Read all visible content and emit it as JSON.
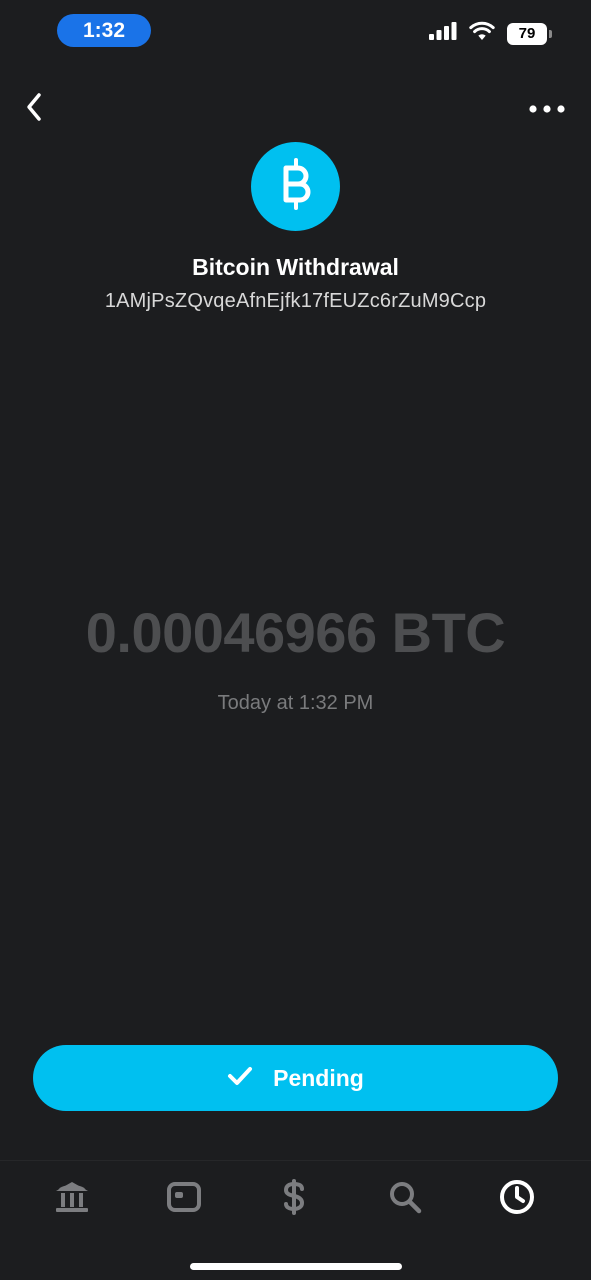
{
  "status_bar": {
    "time": "1:32",
    "battery": "79"
  },
  "header": {
    "back_icon": "chevron-left-icon",
    "more_icon": "more-horizontal-icon"
  },
  "transaction": {
    "icon": "bitcoin-icon",
    "title": "Bitcoin Withdrawal",
    "address": "1AMjPsZQvqeAfnEjfk17fEUZc6rZuM9Ccp",
    "amount": "0.00046966 BTC",
    "timestamp": "Today at 1:32 PM"
  },
  "status_button": {
    "label": "Pending",
    "icon": "checkmark-icon"
  },
  "tabs": [
    {
      "name": "banking",
      "icon": "bank-icon",
      "active": false
    },
    {
      "name": "card",
      "icon": "card-icon",
      "active": false
    },
    {
      "name": "pay",
      "icon": "dollar-icon",
      "active": false
    },
    {
      "name": "discover",
      "icon": "search-icon",
      "active": false
    },
    {
      "name": "activity",
      "icon": "clock-icon",
      "active": true
    }
  ],
  "colors": {
    "background": "#1c1d1f",
    "accent": "#00c0f0",
    "time_pill": "#1a73e8",
    "amount_text": "#4d4e50",
    "inactive_tab": "#7c7d80",
    "active_tab": "#ffffff"
  }
}
